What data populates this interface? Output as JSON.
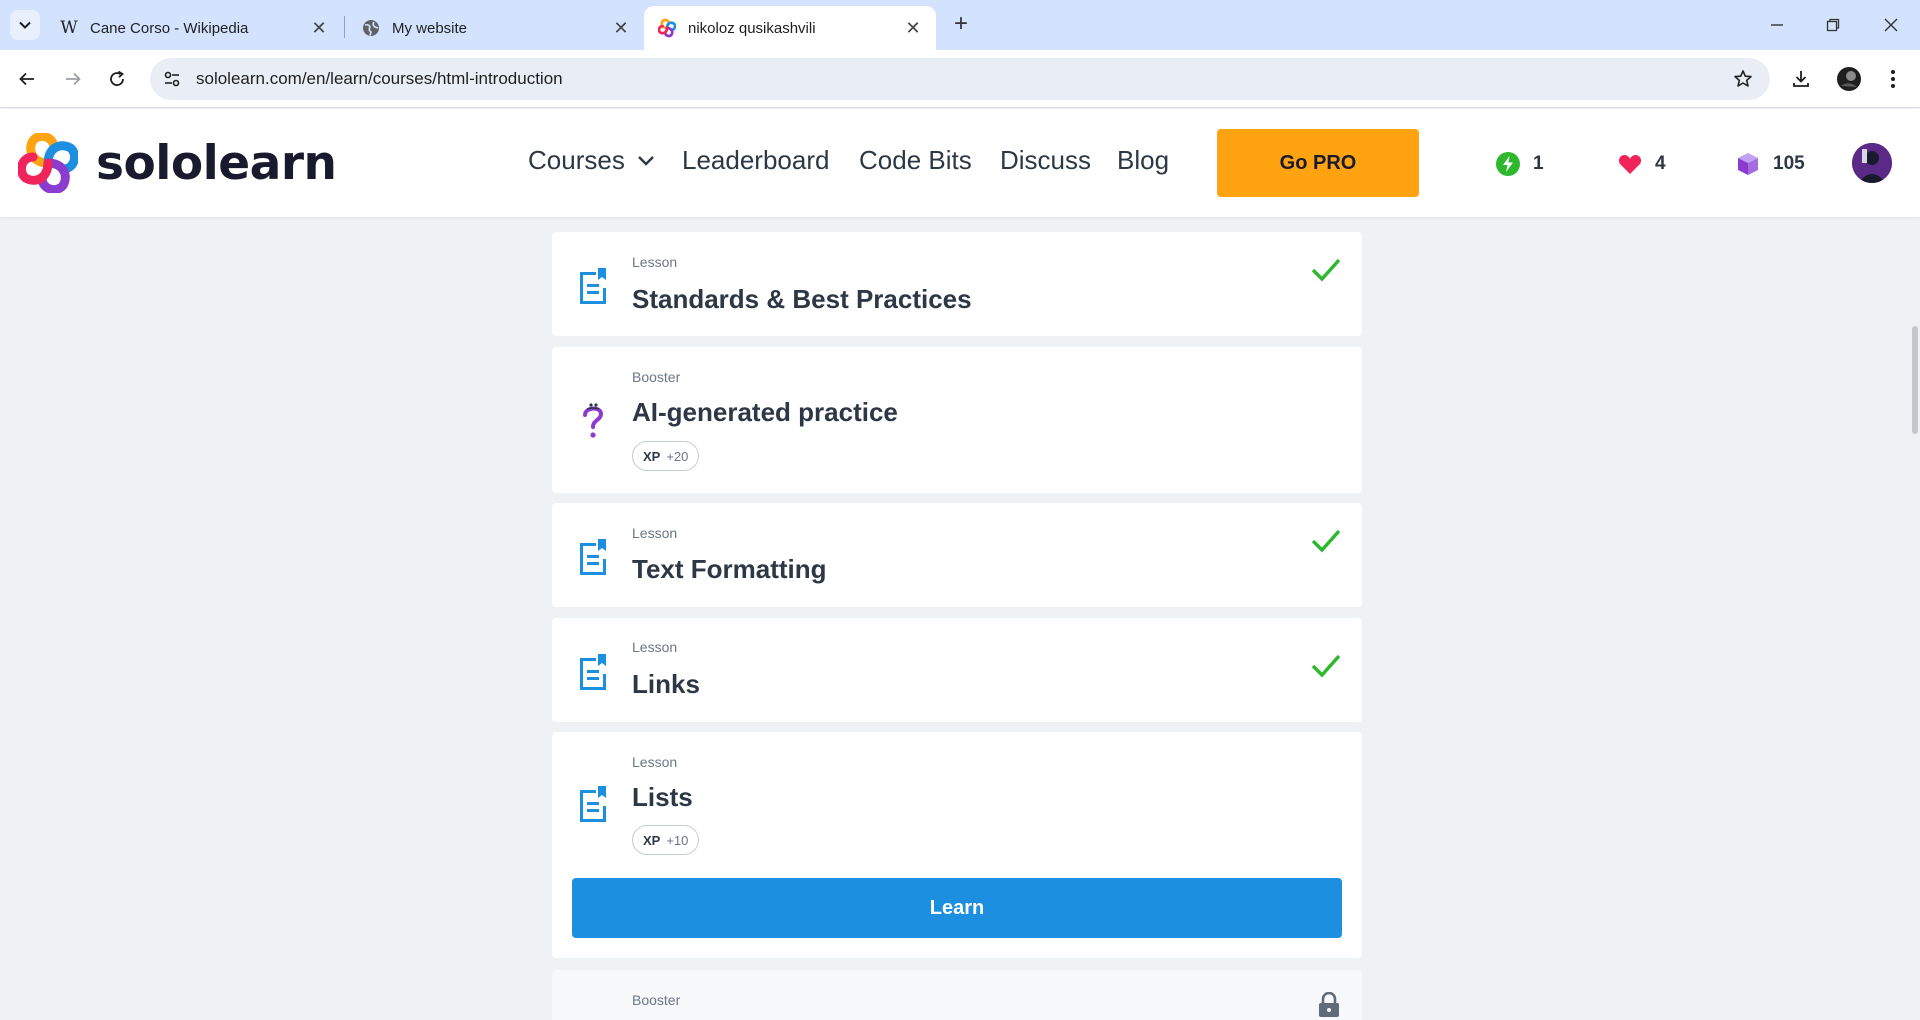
{
  "browser": {
    "tabs": [
      {
        "title": "Cane Corso - Wikipedia",
        "favicon": "wikipedia-icon"
      },
      {
        "title": "My website",
        "favicon": "globe-icon"
      },
      {
        "title": "nikoloz qusikashvili",
        "favicon": "sololearn-icon",
        "active": true
      }
    ],
    "url": "sololearn.com/en/learn/courses/html-introduction"
  },
  "header": {
    "logo_text": "sololearn",
    "nav": {
      "courses": "Courses",
      "leaderboard": "Leaderboard",
      "code_bits": "Code Bits",
      "discuss": "Discuss",
      "blog": "Blog"
    },
    "go_pro": "Go PRO",
    "stats": {
      "streak": "1",
      "hearts": "4",
      "bits": "105"
    }
  },
  "items": [
    {
      "kind": "Lesson",
      "title": "Standards & Best Practices",
      "completed": true
    },
    {
      "kind": "Booster",
      "title": "AI-generated practice",
      "xp_label": "XP",
      "xp_value": "+20"
    },
    {
      "kind": "Lesson",
      "title": "Text Formatting",
      "completed": true
    },
    {
      "kind": "Lesson",
      "title": "Links",
      "completed": true
    },
    {
      "kind": "Lesson",
      "title": "Lists",
      "xp_label": "XP",
      "xp_value": "+10",
      "button": "Learn"
    },
    {
      "kind": "Booster",
      "locked": true
    }
  ],
  "colors": {
    "accent": "#1c8fe0",
    "pro": "#ffa310",
    "check": "#2eb82e",
    "background": "#eef2f5"
  }
}
